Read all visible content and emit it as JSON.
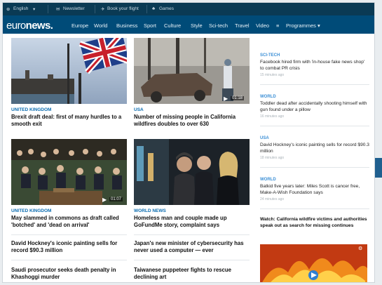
{
  "topbar": {
    "language": "English",
    "newsletter": "Newsletter",
    "book_flight": "Book your flight",
    "games": "Games"
  },
  "brand": {
    "logo_a": "euro",
    "logo_b": "news."
  },
  "nav": {
    "items": [
      "Europe",
      "World",
      "Business",
      "Sport",
      "Culture",
      "Style",
      "Sci-tech",
      "Travel",
      "Video"
    ],
    "programmes": "Programmes"
  },
  "articles": [
    {
      "category": "UNITED KINGDOM",
      "title": "Brexit draft deal: first of many hurdles to a smooth exit"
    },
    {
      "category": "USA",
      "title": "Number of missing people in California wildfires doubles to over 630",
      "duration": "01:18"
    },
    {
      "category": "UNITED KINGDOM",
      "title": "May slammed in commons as draft called 'botched' and 'dead on arrival'",
      "duration": "01:07"
    },
    {
      "category": "WORLD NEWS",
      "title": "Homeless man and couple made up GoFundMe story, complaint says"
    }
  ],
  "headlines": [
    "David Hockney's iconic painting sells for record $90.3 million",
    "Japan's new minister of cybersecurity has never used a computer — ever",
    "Saudi prosecutor seeks death penalty in Khashoggi murder",
    "Taiwanese puppeteer fights to rescue declining art"
  ],
  "sidebar": [
    {
      "category": "SCI-TECH",
      "title": "Facebook hired firm with 'in-house fake news shop' to combat PR crisis",
      "time": "15 minutes ago"
    },
    {
      "category": "WORLD",
      "title": "Toddler dead after accidentally shooting himself with gun found under a pillow",
      "time": "16 minutes ago"
    },
    {
      "category": "USA",
      "title": "David Hockney's iconic painting sells for record $90.3 million",
      "time": "18 minutes ago"
    },
    {
      "category": "WORLD",
      "title": "Batkid five years later: Miles Scott is cancer free, Make-A-Wish Foundation says",
      "time": "24 minutes ago"
    }
  ],
  "watch": {
    "title": "Watch: California wildfire victims and authorities speak out as search for missing continues"
  }
}
